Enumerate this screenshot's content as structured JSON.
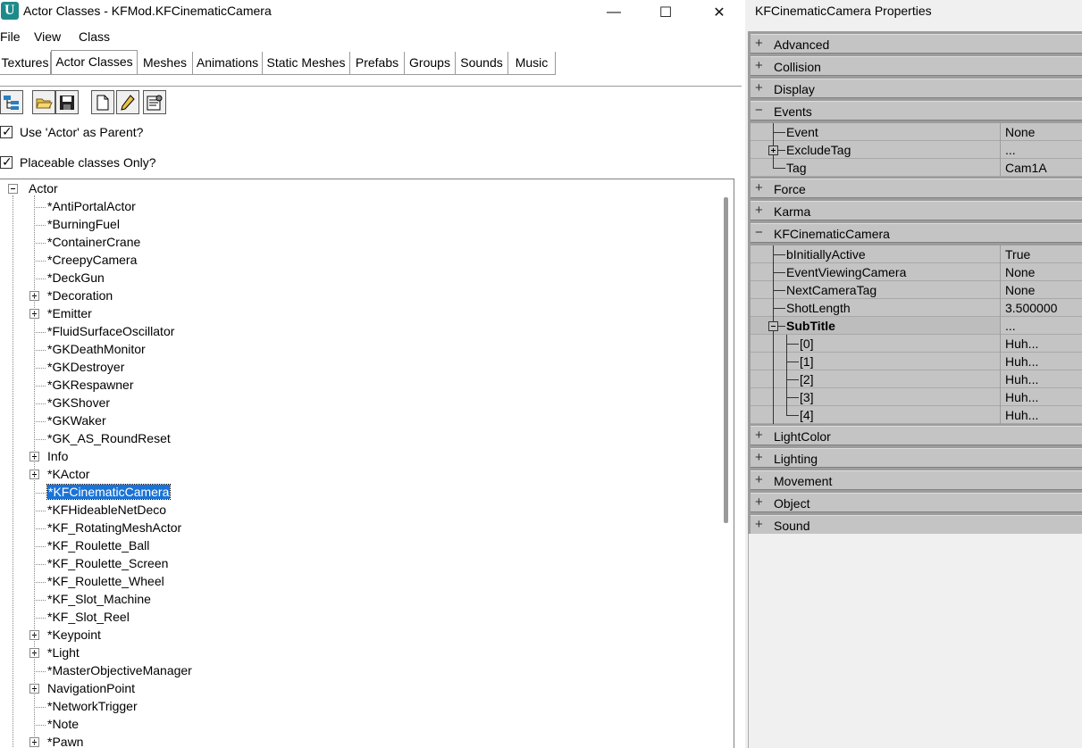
{
  "window": {
    "title": "Actor Classes - KFMod.KFCinematicCamera",
    "minimize": "—",
    "maximize": "☐",
    "close": "✕"
  },
  "menu": [
    "File",
    "View",
    "Class"
  ],
  "tabs": [
    "Textures",
    "Actor Classes",
    "Meshes",
    "Animations",
    "Static Meshes",
    "Prefabs",
    "Groups",
    "Sounds",
    "Music"
  ],
  "toolbar_icons": [
    "class-tree-icon",
    "open-folder-icon",
    "save-icon",
    "new-file-icon",
    "edit-pencil-icon",
    "properties-icon"
  ],
  "options": {
    "use_actor_parent": "Use 'Actor' as Parent?",
    "placeable_only": "Placeable classes Only?"
  },
  "tree": {
    "root": "Actor",
    "items": [
      {
        "label": "*AntiPortalActor",
        "expandable": false
      },
      {
        "label": "*BurningFuel",
        "expandable": false
      },
      {
        "label": "*ContainerCrane",
        "expandable": false
      },
      {
        "label": "*CreepyCamera",
        "expandable": false
      },
      {
        "label": "*DeckGun",
        "expandable": false
      },
      {
        "label": "*Decoration",
        "expandable": true
      },
      {
        "label": "*Emitter",
        "expandable": true
      },
      {
        "label": "*FluidSurfaceOscillator",
        "expandable": false
      },
      {
        "label": "*GKDeathMonitor",
        "expandable": false
      },
      {
        "label": "*GKDestroyer",
        "expandable": false
      },
      {
        "label": "*GKRespawner",
        "expandable": false
      },
      {
        "label": "*GKShover",
        "expandable": false
      },
      {
        "label": "*GKWaker",
        "expandable": false
      },
      {
        "label": "*GK_AS_RoundReset",
        "expandable": false
      },
      {
        "label": "Info",
        "expandable": true
      },
      {
        "label": "*KActor",
        "expandable": true
      },
      {
        "label": "*KFCinematicCamera",
        "expandable": false,
        "selected": true
      },
      {
        "label": "*KFHideableNetDeco",
        "expandable": false
      },
      {
        "label": "*KF_RotatingMeshActor",
        "expandable": false
      },
      {
        "label": "*KF_Roulette_Ball",
        "expandable": false
      },
      {
        "label": "*KF_Roulette_Screen",
        "expandable": false
      },
      {
        "label": "*KF_Roulette_Wheel",
        "expandable": false
      },
      {
        "label": "*KF_Slot_Machine",
        "expandable": false
      },
      {
        "label": "*KF_Slot_Reel",
        "expandable": false
      },
      {
        "label": "*Keypoint",
        "expandable": true
      },
      {
        "label": "*Light",
        "expandable": true
      },
      {
        "label": "*MasterObjectiveManager",
        "expandable": false
      },
      {
        "label": "NavigationPoint",
        "expandable": true
      },
      {
        "label": "*NetworkTrigger",
        "expandable": false
      },
      {
        "label": "*Note",
        "expandable": false
      },
      {
        "label": "*Pawn",
        "expandable": true
      }
    ]
  },
  "properties": {
    "title": "KFCinematicCamera Properties",
    "rows": [
      {
        "kind": "cat",
        "name": "Advanced",
        "open": false
      },
      {
        "kind": "cat",
        "name": "Collision",
        "open": false
      },
      {
        "kind": "cat",
        "name": "Display",
        "open": false
      },
      {
        "kind": "cat",
        "name": "Events",
        "open": true
      },
      {
        "kind": "prop",
        "name": "Event",
        "value": "None",
        "depth": 1,
        "expandable": false
      },
      {
        "kind": "prop",
        "name": "ExcludeTag",
        "value": "...",
        "depth": 1,
        "expandable": true
      },
      {
        "kind": "prop",
        "name": "Tag",
        "value": "Cam1A",
        "depth": 1,
        "expandable": false,
        "last": true
      },
      {
        "kind": "cat",
        "name": "Force",
        "open": false
      },
      {
        "kind": "cat",
        "name": "Karma",
        "open": false
      },
      {
        "kind": "cat",
        "name": "KFCinematicCamera",
        "open": true
      },
      {
        "kind": "prop",
        "name": "bInitiallyActive",
        "value": "True",
        "depth": 1,
        "expandable": false
      },
      {
        "kind": "prop",
        "name": "EventViewingCamera",
        "value": "None",
        "depth": 1,
        "expandable": false
      },
      {
        "kind": "prop",
        "name": "NextCameraTag",
        "value": "None",
        "depth": 1,
        "expandable": false
      },
      {
        "kind": "prop",
        "name": "ShotLength",
        "value": "3.500000",
        "depth": 1,
        "expandable": false
      },
      {
        "kind": "prop",
        "name": "SubTitle",
        "value": "...",
        "depth": 1,
        "expandable": true,
        "expanded": true,
        "bold": true
      },
      {
        "kind": "prop",
        "name": "[0]",
        "value": "Huh...",
        "depth": 2,
        "expandable": false
      },
      {
        "kind": "prop",
        "name": "[1]",
        "value": "Huh...",
        "depth": 2,
        "expandable": false
      },
      {
        "kind": "prop",
        "name": "[2]",
        "value": "Huh...",
        "depth": 2,
        "expandable": false
      },
      {
        "kind": "prop",
        "name": "[3]",
        "value": "Huh...",
        "depth": 2,
        "expandable": false
      },
      {
        "kind": "prop",
        "name": "[4]",
        "value": "Huh...",
        "depth": 2,
        "expandable": false,
        "last": true
      },
      {
        "kind": "cat",
        "name": "LightColor",
        "open": false
      },
      {
        "kind": "cat",
        "name": "Lighting",
        "open": false
      },
      {
        "kind": "cat",
        "name": "Movement",
        "open": false
      },
      {
        "kind": "cat",
        "name": "Object",
        "open": false
      },
      {
        "kind": "cat",
        "name": "Sound",
        "open": false
      }
    ]
  },
  "colors": {
    "selection": "#1a73d6",
    "property_bg": "#c4c4c4",
    "panel_bg": "#9c9c9c"
  }
}
